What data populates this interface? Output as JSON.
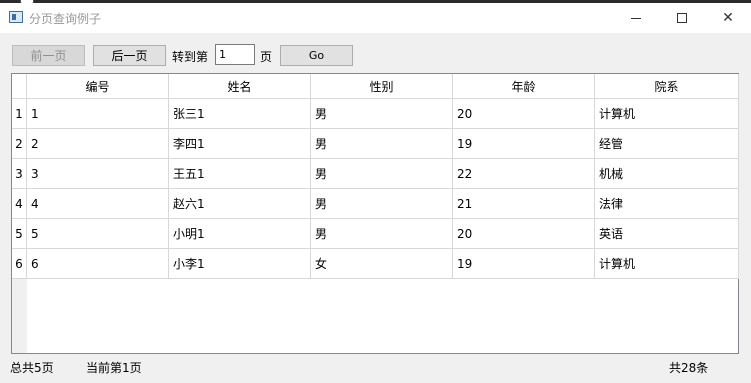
{
  "window": {
    "title": "分页查询例子",
    "icon": "app-window-icon",
    "controls": [
      "minimize-icon",
      "maximize-icon",
      "close-icon"
    ]
  },
  "toolbar": {
    "prev_label": "前一页",
    "next_label": "后一页",
    "goto_label": "转到第",
    "page_value": "1",
    "page_suffix": "页",
    "go_label": "Go"
  },
  "table": {
    "columns": [
      "编号",
      "姓名",
      "性别",
      "年龄",
      "院系"
    ],
    "row_numbers": [
      "1",
      "2",
      "3",
      "4",
      "5",
      "6"
    ],
    "rows": [
      [
        "1",
        "张三1",
        "男",
        "20",
        "计算机"
      ],
      [
        "2",
        "李四1",
        "男",
        "19",
        "经管"
      ],
      [
        "3",
        "王五1",
        "男",
        "22",
        "机械"
      ],
      [
        "4",
        "赵六1",
        "男",
        "21",
        "法律"
      ],
      [
        "5",
        "小明1",
        "男",
        "20",
        "英语"
      ],
      [
        "6",
        "小李1",
        "女",
        "19",
        "计算机"
      ]
    ]
  },
  "status": {
    "total_pages": "总共5页",
    "current_page": "当前第1页",
    "total_records": "共28条"
  }
}
